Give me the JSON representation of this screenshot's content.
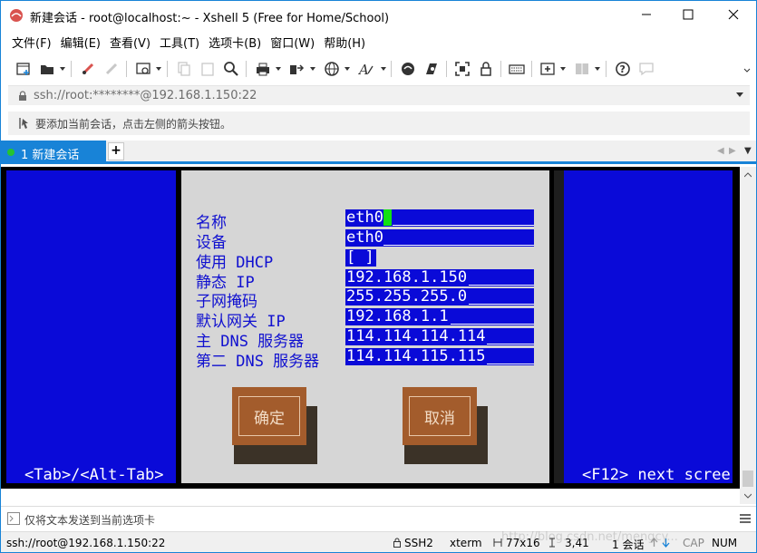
{
  "window": {
    "title": "新建会话 - root@localhost:~ - Xshell 5 (Free for Home/School)",
    "accent_color": "#1883d7"
  },
  "menu": [
    {
      "label": "文件(F)"
    },
    {
      "label": "编辑(E)"
    },
    {
      "label": "查看(V)"
    },
    {
      "label": "工具(T)"
    },
    {
      "label": "选项卡(B)"
    },
    {
      "label": "窗口(W)"
    },
    {
      "label": "帮助(H)"
    }
  ],
  "address": {
    "value": "ssh://root:********@192.168.1.150:22"
  },
  "info": {
    "text": "要添加当前会话，点击左侧的箭头按钮。"
  },
  "tabs": {
    "active_label": "1 新建会话",
    "add_label": "+"
  },
  "terminal": {
    "background": "#0a0ad8",
    "fields": [
      {
        "label": "名称",
        "value": "eth0"
      },
      {
        "label": "设备",
        "value": "eth0"
      },
      {
        "label": "使用 DHCP",
        "value": "[ ]"
      },
      {
        "label": "静态 IP",
        "value": "192.168.1.150"
      },
      {
        "label": "子网掩码",
        "value": "255.255.255.0"
      },
      {
        "label": "默认网关 IP",
        "value": "192.168.1.1"
      },
      {
        "label": "主 DNS 服务器",
        "value": "114.114.114.114"
      },
      {
        "label": "第二 DNS 服务器",
        "value": "114.114.115.115"
      }
    ],
    "ok_label": "确定",
    "cancel_label": "取消",
    "hint_left": "<Tab>/<Alt-Tab>",
    "hint_right": "<F12> next scree"
  },
  "send_bar": {
    "text": "仅将文本发送到当前选项卡"
  },
  "status": {
    "session": "ssh://root@192.168.1.150:22",
    "protocol": "SSH2",
    "term": "xterm",
    "size": "77x16",
    "position": "3,41",
    "sessions": "1 会话",
    "caps": "CAP",
    "num": "NUM"
  },
  "watermark": "http://blog.csdn.net/mengcy..."
}
